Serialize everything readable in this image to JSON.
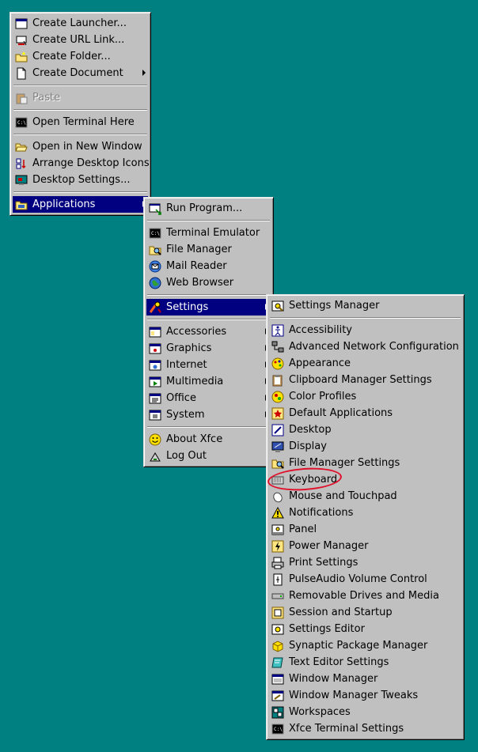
{
  "desktop_menu": {
    "items": [
      {
        "label": "Create Launcher...",
        "icon": "launcher-icon"
      },
      {
        "label": "Create URL Link...",
        "icon": "url-link-icon"
      },
      {
        "label": "Create Folder...",
        "icon": "new-folder-icon"
      },
      {
        "label": "Create Document",
        "icon": "document-icon",
        "submenu": true
      },
      {
        "separator": true
      },
      {
        "label": "Paste",
        "icon": "paste-icon",
        "disabled": true
      },
      {
        "separator": true
      },
      {
        "label": "Open Terminal Here",
        "icon": "terminal-icon"
      },
      {
        "separator": true
      },
      {
        "label": "Open in New Window",
        "icon": "open-folder-icon"
      },
      {
        "label": "Arrange Desktop Icons",
        "icon": "arrange-icon"
      },
      {
        "label": "Desktop Settings...",
        "icon": "desktop-settings-icon"
      },
      {
        "separator": true
      },
      {
        "label": "Applications",
        "icon": "applications-icon",
        "submenu": true,
        "selected": true
      }
    ]
  },
  "applications_menu": {
    "items": [
      {
        "label": "Run Program...",
        "icon": "run-program-icon"
      },
      {
        "separator": true
      },
      {
        "label": "Terminal Emulator",
        "icon": "terminal-icon"
      },
      {
        "label": "File Manager",
        "icon": "file-manager-icon"
      },
      {
        "label": "Mail Reader",
        "icon": "mail-icon"
      },
      {
        "label": "Web Browser",
        "icon": "web-browser-icon"
      },
      {
        "separator": true
      },
      {
        "label": "Settings",
        "icon": "settings-icon",
        "submenu": true,
        "selected": true
      },
      {
        "separator": true
      },
      {
        "label": "Accessories",
        "icon": "accessories-icon",
        "submenu": true
      },
      {
        "label": "Graphics",
        "icon": "graphics-icon",
        "submenu": true
      },
      {
        "label": "Internet",
        "icon": "internet-icon",
        "submenu": true
      },
      {
        "label": "Multimedia",
        "icon": "multimedia-icon",
        "submenu": true
      },
      {
        "label": "Office",
        "icon": "office-icon",
        "submenu": true
      },
      {
        "label": "System",
        "icon": "system-icon",
        "submenu": true
      },
      {
        "separator": true
      },
      {
        "label": "About Xfce",
        "icon": "smiley-icon"
      },
      {
        "label": "Log Out",
        "icon": "log-out-icon"
      }
    ]
  },
  "settings_menu": {
    "items": [
      {
        "label": "Settings Manager",
        "icon": "settings-manager-icon"
      },
      {
        "separator": true
      },
      {
        "label": "Accessibility",
        "icon": "accessibility-icon"
      },
      {
        "label": "Advanced Network Configuration",
        "icon": "network-icon"
      },
      {
        "label": "Appearance",
        "icon": "appearance-icon"
      },
      {
        "label": "Clipboard Manager Settings",
        "icon": "clipboard-icon"
      },
      {
        "label": "Color Profiles",
        "icon": "color-profiles-icon"
      },
      {
        "label": "Default Applications",
        "icon": "default-apps-icon"
      },
      {
        "label": "Desktop",
        "icon": "desktop-icon"
      },
      {
        "label": "Display",
        "icon": "display-icon"
      },
      {
        "label": "File Manager Settings",
        "icon": "file-manager-icon"
      },
      {
        "label": "Keyboard",
        "icon": "keyboard-icon"
      },
      {
        "label": "Mouse and Touchpad",
        "icon": "mouse-icon"
      },
      {
        "label": "Notifications",
        "icon": "warning-icon"
      },
      {
        "label": "Panel",
        "icon": "panel-icon"
      },
      {
        "label": "Power Manager",
        "icon": "power-manager-icon"
      },
      {
        "label": "Print Settings",
        "icon": "printer-icon"
      },
      {
        "label": "PulseAudio Volume Control",
        "icon": "volume-icon"
      },
      {
        "label": "Removable Drives and Media",
        "icon": "removable-drive-icon"
      },
      {
        "label": "Session and Startup",
        "icon": "session-icon"
      },
      {
        "label": "Settings Editor",
        "icon": "settings-editor-icon"
      },
      {
        "label": "Synaptic Package Manager",
        "icon": "package-icon"
      },
      {
        "label": "Text Editor Settings",
        "icon": "text-editor-icon"
      },
      {
        "label": "Window Manager",
        "icon": "window-manager-icon"
      },
      {
        "label": "Window Manager Tweaks",
        "icon": "window-tweaks-icon"
      },
      {
        "label": "Workspaces",
        "icon": "workspaces-icon"
      },
      {
        "label": "Xfce Terminal Settings",
        "icon": "terminal-icon"
      }
    ]
  },
  "annotation": {
    "circled_item": "Keyboard",
    "color": "#e0102a"
  },
  "colors": {
    "desktop": "#008080",
    "menu": "#c0c0c0",
    "selection": "#000080"
  }
}
